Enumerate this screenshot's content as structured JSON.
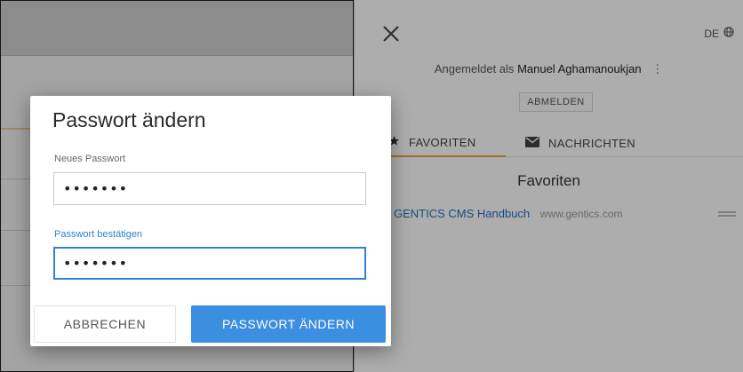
{
  "drawer": {
    "language": "DE",
    "logged_in_prefix": "Angemeldet als",
    "user_name": "Manuel Aghamanoukjan",
    "logout_label": "ABMELDEN",
    "tabs": [
      {
        "label": "FAVORITEN",
        "icon": "star-icon"
      },
      {
        "label": "NACHRICHTEN",
        "icon": "envelope-icon"
      }
    ],
    "favorites_heading": "Favoriten",
    "favorites": [
      {
        "title": "GENTICS CMS Handbuch",
        "url": "www.gentics.com"
      }
    ]
  },
  "modal": {
    "title": "Passwort ändern",
    "new_password_label": "Neues Passwort",
    "new_password_value": "•••••••",
    "confirm_password_label": "Passwort bestätigen",
    "confirm_password_value": "•••••••",
    "cancel_label": "ABBRECHEN",
    "submit_label": "PASSWORT ÄNDERN"
  },
  "colors": {
    "accent": "#3c8ee0",
    "focus_border": "#2e82d6",
    "tab_indicator": "#e6a23c",
    "link": "#1f70c1"
  }
}
